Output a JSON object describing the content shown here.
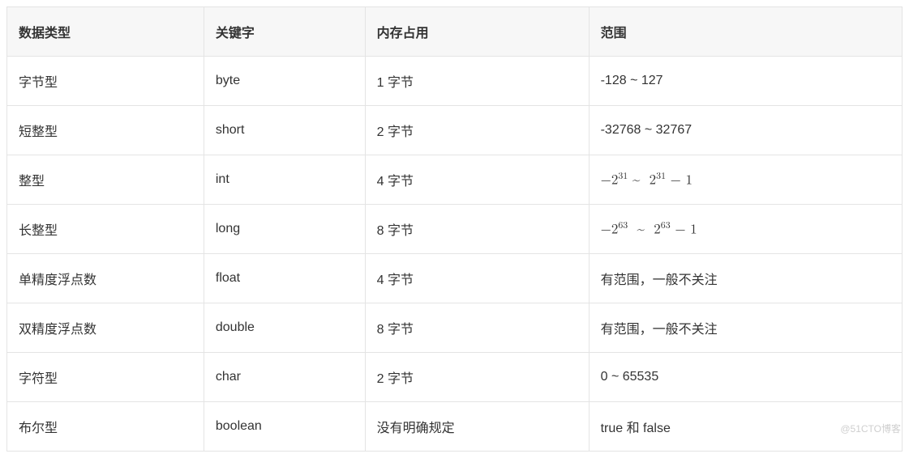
{
  "table": {
    "headers": [
      "数据类型",
      "关键字",
      "内存占用",
      "范围"
    ],
    "rows": [
      {
        "type": "字节型",
        "keyword": "byte",
        "memory": "1 字节",
        "range": "-128 ~ 127",
        "range_math": false
      },
      {
        "type": "短整型",
        "keyword": "short",
        "memory": "2 字节",
        "range": "-32768 ~ 32767",
        "range_math": false
      },
      {
        "type": "整型",
        "keyword": "int",
        "memory": "4 字节",
        "range": "−2³¹ ~ 2³¹ − 1",
        "range_math": true,
        "exp": "31"
      },
      {
        "type": "长整型",
        "keyword": "long",
        "memory": "8 字节",
        "range": "−2⁶³ ~ 2⁶³ − 1",
        "range_math": true,
        "exp": "63"
      },
      {
        "type": "单精度浮点数",
        "keyword": "float",
        "memory": "4 字节",
        "range": "有范围，一般不关注",
        "range_math": false
      },
      {
        "type": "双精度浮点数",
        "keyword": "double",
        "memory": "8 字节",
        "range": "有范围，一般不关注",
        "range_math": false
      },
      {
        "type": "字符型",
        "keyword": "char",
        "memory": "2 字节",
        "range": "0 ~ 65535",
        "range_math": false
      },
      {
        "type": "布尔型",
        "keyword": "boolean",
        "memory": "没有明确规定",
        "range": "true 和 false",
        "range_math": false
      }
    ]
  },
  "watermark": "@51CTO博客"
}
